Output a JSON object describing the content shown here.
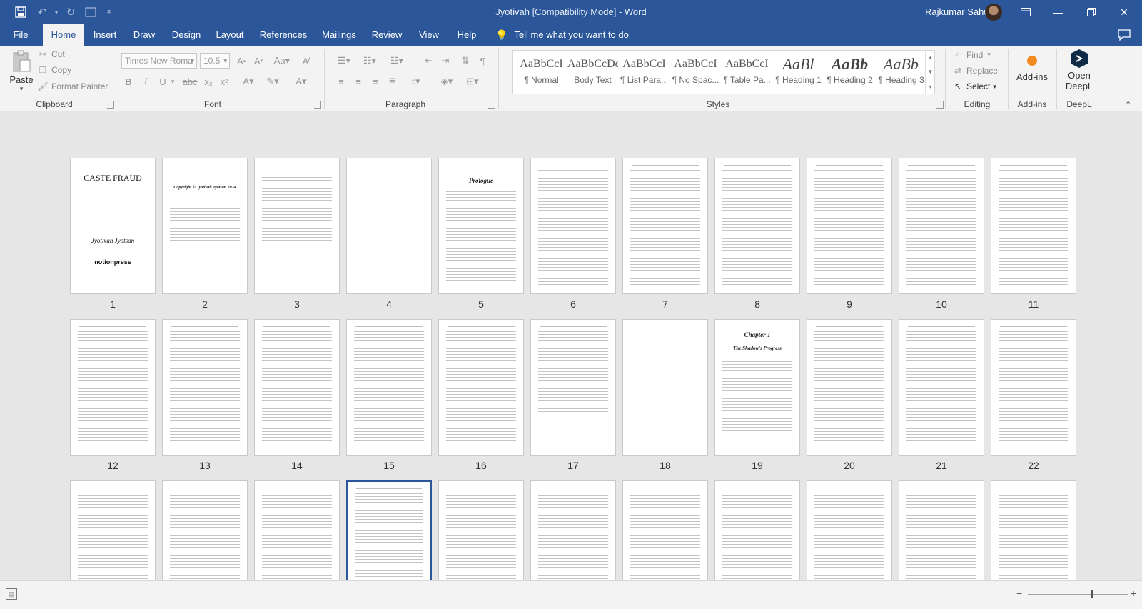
{
  "titlebar": {
    "doc_title": "Jyotivah [Compatibility Mode]  -  Word",
    "user_name": "Rajkumar Sahu",
    "qat": [
      "save-icon",
      "undo-icon",
      "redo-icon",
      "touch-mode-icon",
      "customize-icon"
    ]
  },
  "tabs": [
    {
      "label": "File",
      "active": false
    },
    {
      "label": "Home",
      "active": true
    },
    {
      "label": "Insert",
      "active": false
    },
    {
      "label": "Draw",
      "active": false
    },
    {
      "label": "Design",
      "active": false
    },
    {
      "label": "Layout",
      "active": false
    },
    {
      "label": "References",
      "active": false
    },
    {
      "label": "Mailings",
      "active": false
    },
    {
      "label": "Review",
      "active": false
    },
    {
      "label": "View",
      "active": false
    },
    {
      "label": "Help",
      "active": false
    }
  ],
  "tell_me": "Tell me what you want to do",
  "ribbon": {
    "clipboard": {
      "paste": "Paste",
      "cut": "Cut",
      "copy": "Copy",
      "format_painter": "Format Painter",
      "group_label": "Clipboard"
    },
    "font": {
      "font_name": "Times New Roma",
      "font_size": "10.5",
      "group_label": "Font"
    },
    "paragraph": {
      "group_label": "Paragraph"
    },
    "styles": {
      "group_label": "Styles",
      "items": [
        {
          "sample": "AaBbCcI",
          "name": "¶ Normal"
        },
        {
          "sample": "AaBbCcDc",
          "name": "Body Text"
        },
        {
          "sample": "AaBbCcI",
          "name": "¶ List Para..."
        },
        {
          "sample": "AaBbCcI",
          "name": "¶ No Spac..."
        },
        {
          "sample": "AaBbCcI",
          "name": "¶ Table Pa..."
        },
        {
          "sample": "AaBl",
          "name": "¶ Heading 1"
        },
        {
          "sample": "AaBb",
          "name": "¶ Heading 2"
        },
        {
          "sample": "AaBb",
          "name": "¶ Heading 3"
        }
      ]
    },
    "editing": {
      "find": "Find",
      "replace": "Replace",
      "select": "Select",
      "group_label": "Editing"
    },
    "addins": {
      "button": "Add-ins",
      "group_label": "Add-ins"
    },
    "deepl": {
      "button_line1": "Open",
      "button_line2": "DeepL",
      "group_label": "DeepL"
    }
  },
  "pages": {
    "cover_title": "CASTE FRAUD",
    "cover_author": "Jyotivah Jyotsan",
    "cover_publisher": "notionpress",
    "copyright_heading": "Copyright © Jyotivah Jyotsan 2024",
    "prologue_heading": "Prologue",
    "chapter_heading": "Chapter 1",
    "chapter_subtitle": "The Shadow's Progress",
    "numbers": [
      "1",
      "2",
      "3",
      "4",
      "5",
      "6",
      "7",
      "8",
      "9",
      "10",
      "11",
      "12",
      "13",
      "14",
      "15",
      "16",
      "17",
      "18",
      "19",
      "20",
      "21",
      "22"
    ]
  }
}
